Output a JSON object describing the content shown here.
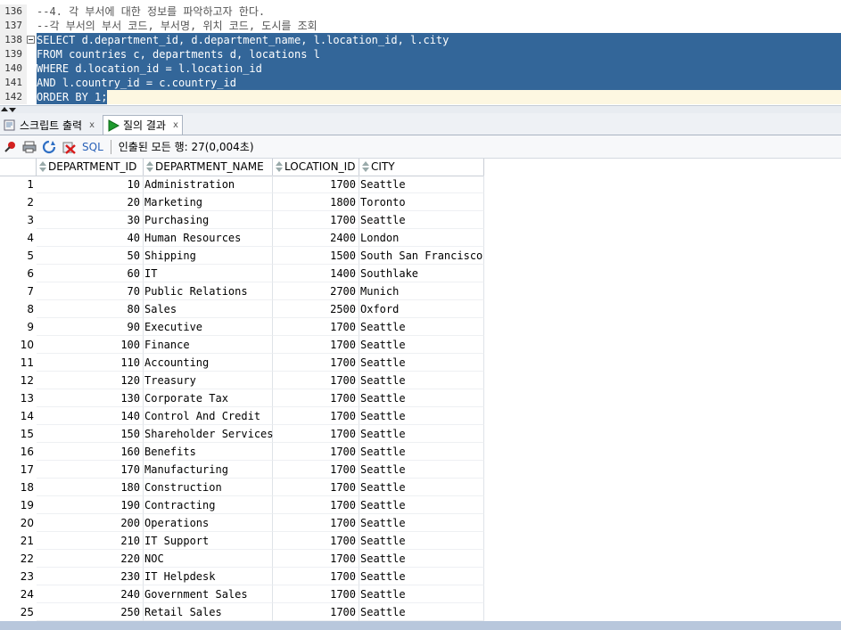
{
  "editor": {
    "lines": [
      {
        "num": "136",
        "text": "--4. 각 부서에 대한 정보를 파악하고자 한다.",
        "kind": "comment"
      },
      {
        "num": "137",
        "text": "--각 부서의 부서 코드, 부서명, 위치 코드, 도시를 조회",
        "kind": "comment"
      },
      {
        "num": "138",
        "text": "SELECT d.department_id, d.department_name, l.location_id, l.city",
        "kind": "selected"
      },
      {
        "num": "139",
        "text": "FROM countries c, departments d, locations l",
        "kind": "selected"
      },
      {
        "num": "140",
        "text": "WHERE d.location_id = l.location_id",
        "kind": "selected"
      },
      {
        "num": "141",
        "text": "AND l.country_id = c.country_id",
        "kind": "selected"
      },
      {
        "num": "142",
        "text": "ORDER BY 1;",
        "kind": "selected-last"
      }
    ]
  },
  "tabs": [
    {
      "label": "스크립트 출력",
      "close": "x"
    },
    {
      "label": "질의 결과",
      "close": "x"
    }
  ],
  "toolbar": {
    "sql_label": "SQL",
    "status": "인출된 모든 행: 27(0,004초)"
  },
  "grid": {
    "columns": [
      "DEPARTMENT_ID",
      "DEPARTMENT_NAME",
      "LOCATION_ID",
      "CITY"
    ],
    "rows": [
      [
        "1",
        "10",
        "Administration",
        "1700",
        "Seattle"
      ],
      [
        "2",
        "20",
        "Marketing",
        "1800",
        "Toronto"
      ],
      [
        "3",
        "30",
        "Purchasing",
        "1700",
        "Seattle"
      ],
      [
        "4",
        "40",
        "Human Resources",
        "2400",
        "London"
      ],
      [
        "5",
        "50",
        "Shipping",
        "1500",
        "South San Francisco"
      ],
      [
        "6",
        "60",
        "IT",
        "1400",
        "Southlake"
      ],
      [
        "7",
        "70",
        "Public Relations",
        "2700",
        "Munich"
      ],
      [
        "8",
        "80",
        "Sales",
        "2500",
        "Oxford"
      ],
      [
        "9",
        "90",
        "Executive",
        "1700",
        "Seattle"
      ],
      [
        "10",
        "100",
        "Finance",
        "1700",
        "Seattle"
      ],
      [
        "11",
        "110",
        "Accounting",
        "1700",
        "Seattle"
      ],
      [
        "12",
        "120",
        "Treasury",
        "1700",
        "Seattle"
      ],
      [
        "13",
        "130",
        "Corporate Tax",
        "1700",
        "Seattle"
      ],
      [
        "14",
        "140",
        "Control And Credit",
        "1700",
        "Seattle"
      ],
      [
        "15",
        "150",
        "Shareholder Services",
        "1700",
        "Seattle"
      ],
      [
        "16",
        "160",
        "Benefits",
        "1700",
        "Seattle"
      ],
      [
        "17",
        "170",
        "Manufacturing",
        "1700",
        "Seattle"
      ],
      [
        "18",
        "180",
        "Construction",
        "1700",
        "Seattle"
      ],
      [
        "19",
        "190",
        "Contracting",
        "1700",
        "Seattle"
      ],
      [
        "20",
        "200",
        "Operations",
        "1700",
        "Seattle"
      ],
      [
        "21",
        "210",
        "IT Support",
        "1700",
        "Seattle"
      ],
      [
        "22",
        "220",
        "NOC",
        "1700",
        "Seattle"
      ],
      [
        "23",
        "230",
        "IT Helpdesk",
        "1700",
        "Seattle"
      ],
      [
        "24",
        "240",
        "Government Sales",
        "1700",
        "Seattle"
      ],
      [
        "25",
        "250",
        "Retail Sales",
        "1700",
        "Seattle"
      ]
    ]
  },
  "colors": {
    "selection": "#336699",
    "current_line": "#fdf7e1",
    "run_icon": "#1e9a2e",
    "sql_link": "#2a62b8"
  }
}
